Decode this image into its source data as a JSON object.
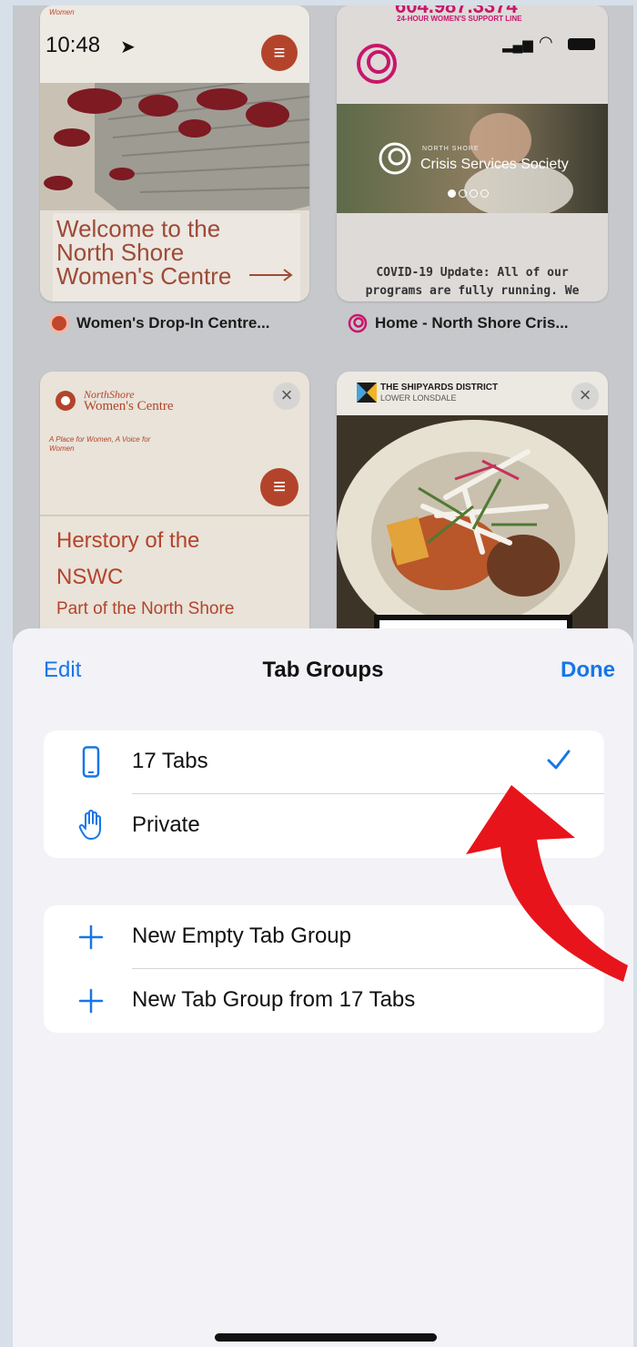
{
  "status_bar": {
    "time": "10:48"
  },
  "tabs": [
    {
      "title": "Women's Drop-In Centre...",
      "preview_tag": "Women",
      "preview_text": "Welcome to the North Shore Women's Centre",
      "favicon_color": "#c0462b"
    },
    {
      "title": "Home - North Shore Cris...",
      "phone_number": "604.987.3374",
      "support_line": "24-HOUR WOMEN'S SUPPORT LINE",
      "brand_small": "NORTH SHORE",
      "brand": "Crisis Services Society",
      "notice_line1": "COVID-19 Update: All of our",
      "notice_line2": "programs are fully running. We",
      "favicon_color": "#c8166b"
    },
    {
      "logo_line1": "NorthShore",
      "logo_line2": "Women's Centre",
      "tagline_line1": "A Place for Women, A Voice for",
      "tagline_line2": "Women",
      "heading_line1": "Herstory of the",
      "heading_line2": "NSWC",
      "subheading": "Part of the North Shore",
      "close_glyph": "×"
    },
    {
      "brand_line1": "THE SHIPYARDS DISTRICT",
      "brand_line2": "LOWER LONSDALE",
      "close_glyph": "×"
    }
  ],
  "sheet": {
    "edit_label": "Edit",
    "title": "Tab Groups",
    "done_label": "Done",
    "groups": [
      {
        "label": "17 Tabs",
        "icon": "iphone-icon",
        "selected": true
      },
      {
        "label": "Private",
        "icon": "hand-icon",
        "selected": false
      }
    ],
    "actions": [
      {
        "label": "New Empty Tab Group",
        "icon": "plus-icon"
      },
      {
        "label": "New Tab Group from 17 Tabs",
        "icon": "plus-icon"
      }
    ]
  },
  "colors": {
    "accent": "#1676e8",
    "annotation_arrow": "#e8141b",
    "nswc_brand": "#b3442b"
  }
}
